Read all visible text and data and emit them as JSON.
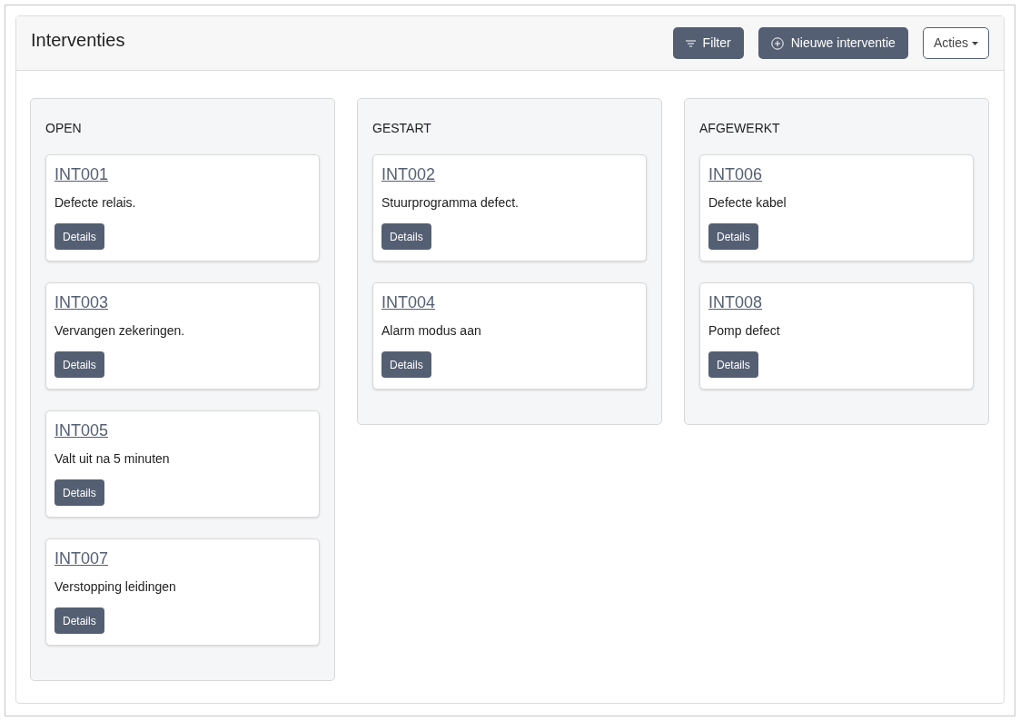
{
  "title": "Interventies",
  "actions": [
    {
      "kind": "filter",
      "label": "Filter"
    },
    {
      "kind": "new",
      "label": "Nieuwe interventie"
    },
    {
      "kind": "dropdown",
      "label": "Acties"
    }
  ],
  "columns": [
    {
      "title": "OPEN",
      "cards": [
        {
          "code": "INT001",
          "description": "Defecte relais.",
          "button": "Details"
        },
        {
          "code": "INT003",
          "description": "Vervangen zekeringen.",
          "button": "Details"
        },
        {
          "code": "INT005",
          "description": "Valt uit na 5 minuten",
          "button": "Details"
        },
        {
          "code": "INT007",
          "description": "Verstopping leidingen",
          "button": "Details"
        }
      ]
    },
    {
      "title": "GESTART",
      "cards": [
        {
          "code": "INT002",
          "description": "Stuurprogramma defect.",
          "button": "Details"
        },
        {
          "code": "INT004",
          "description": "Alarm modus aan",
          "button": "Details"
        }
      ]
    },
    {
      "title": "AFGEWERKT",
      "cards": [
        {
          "code": "INT006",
          "description": "Defecte kabel",
          "button": "Details"
        },
        {
          "code": "INT008",
          "description": "Pomp defect",
          "button": "Details"
        }
      ]
    }
  ]
}
